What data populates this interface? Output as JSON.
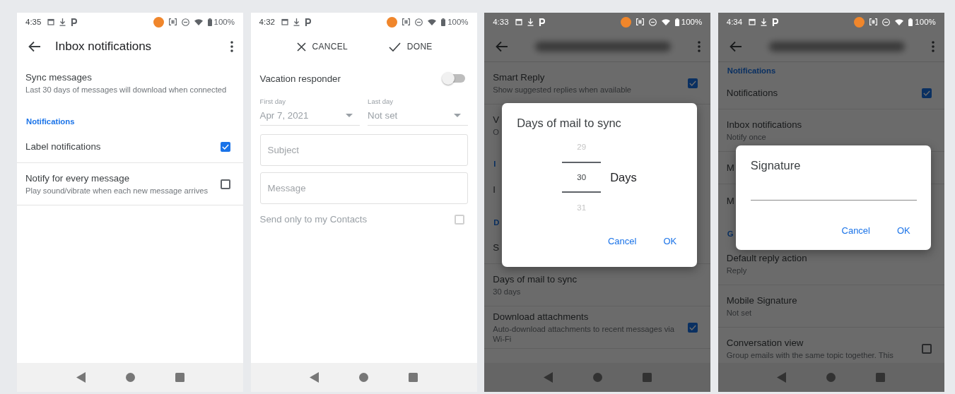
{
  "screens": [
    {
      "status_bar": {
        "time": "4:35",
        "battery": "100%"
      },
      "toolbar": {
        "kind": "title",
        "title": "Inbox notifications"
      },
      "rows": [
        {
          "kind": "item",
          "title": "Sync messages",
          "subtitle": "Last 30 days of messages will download when connected"
        },
        {
          "kind": "header",
          "title": "Notifications"
        },
        {
          "kind": "check",
          "title": "Label notifications",
          "checked": true
        },
        {
          "kind": "check",
          "title": "Notify for every message",
          "subtitle": "Play sound/vibrate when each new message arrives",
          "checked": false
        }
      ]
    },
    {
      "status_bar": {
        "time": "4:32",
        "battery": "100%"
      },
      "toolbar": {
        "kind": "actions",
        "actions": [
          {
            "kind": "cancel",
            "label": "CANCEL"
          },
          {
            "kind": "done",
            "label": "DONE"
          }
        ]
      },
      "form": {
        "responder": {
          "label": "Vacation responder",
          "on": false
        },
        "dates": [
          {
            "label": "First day",
            "value": "Apr 7, 2021"
          },
          {
            "label": "Last day",
            "value": "Not set"
          }
        ],
        "fields": [
          {
            "placeholder": "Subject"
          },
          {
            "placeholder": "Message"
          }
        ],
        "contacts_only": {
          "label": "Send only to my Contacts",
          "checked": false,
          "disabled": true
        }
      }
    },
    {
      "status_bar": {
        "time": "4:33",
        "battery": "100%"
      },
      "toolbar": {
        "kind": "blurred"
      },
      "rows": [
        {
          "kind": "check",
          "title": "Smart Reply",
          "subtitle": "Show suggested replies when available",
          "checked": true
        },
        {
          "kind": "item",
          "title": "V",
          "subtitle": "O"
        },
        {
          "kind": "header",
          "title": "I"
        },
        {
          "kind": "item",
          "title": "I"
        },
        {
          "kind": "header",
          "title": "D"
        },
        {
          "kind": "item",
          "title": "S"
        },
        {
          "kind": "item",
          "title": "Days of mail to sync",
          "subtitle": "30 days"
        },
        {
          "kind": "check",
          "title": "Download attachments",
          "subtitle": "Auto-download attachments to recent messages via Wi-Fi",
          "checked": true
        }
      ],
      "dialog": {
        "kind": "picker",
        "title": "Days of mail to sync",
        "options": [
          {
            "value": "29",
            "selected": false
          },
          {
            "value": "30",
            "selected": true
          },
          {
            "value": "31",
            "selected": false
          }
        ],
        "unit": "Days",
        "buttons": [
          "Cancel",
          "OK"
        ]
      }
    },
    {
      "status_bar": {
        "time": "4:34",
        "battery": "100%"
      },
      "toolbar": {
        "kind": "blurred"
      },
      "rows": [
        {
          "kind": "header",
          "title": "Notifications"
        },
        {
          "kind": "check",
          "title": "Notifications",
          "checked": true
        },
        {
          "kind": "item",
          "title": "Inbox notifications",
          "subtitle": "Notify once"
        },
        {
          "kind": "item",
          "title": "M"
        },
        {
          "kind": "item",
          "title": "M"
        },
        {
          "kind": "header",
          "title": "G"
        },
        {
          "kind": "item",
          "title": "Default reply action",
          "subtitle": "Reply"
        },
        {
          "kind": "item",
          "title": "Mobile Signature",
          "subtitle": "Not set"
        },
        {
          "kind": "check",
          "title": "Conversation view",
          "subtitle": "Group emails with the same topic together. This",
          "checked": false
        }
      ],
      "dialog": {
        "kind": "text",
        "title": "Signature",
        "buttons": [
          "Cancel",
          "OK"
        ]
      }
    }
  ]
}
